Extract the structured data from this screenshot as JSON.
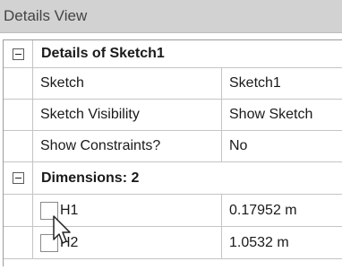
{
  "title": "Details View",
  "groups": [
    {
      "title": "Details of Sketch1",
      "rows": [
        {
          "name": "Sketch",
          "value": "Sketch1"
        },
        {
          "name": "Sketch Visibility",
          "value": "Show Sketch"
        },
        {
          "name": "Show Constraints?",
          "value": "No"
        }
      ]
    },
    {
      "title": "Dimensions: 2",
      "rows": [
        {
          "name": "H1",
          "value": "0.17952 m"
        },
        {
          "name": "H2",
          "value": "1.0532 m"
        }
      ]
    }
  ],
  "icons": {
    "expander": "collapse-icon",
    "cursor": "mouse-pointer-icon"
  }
}
